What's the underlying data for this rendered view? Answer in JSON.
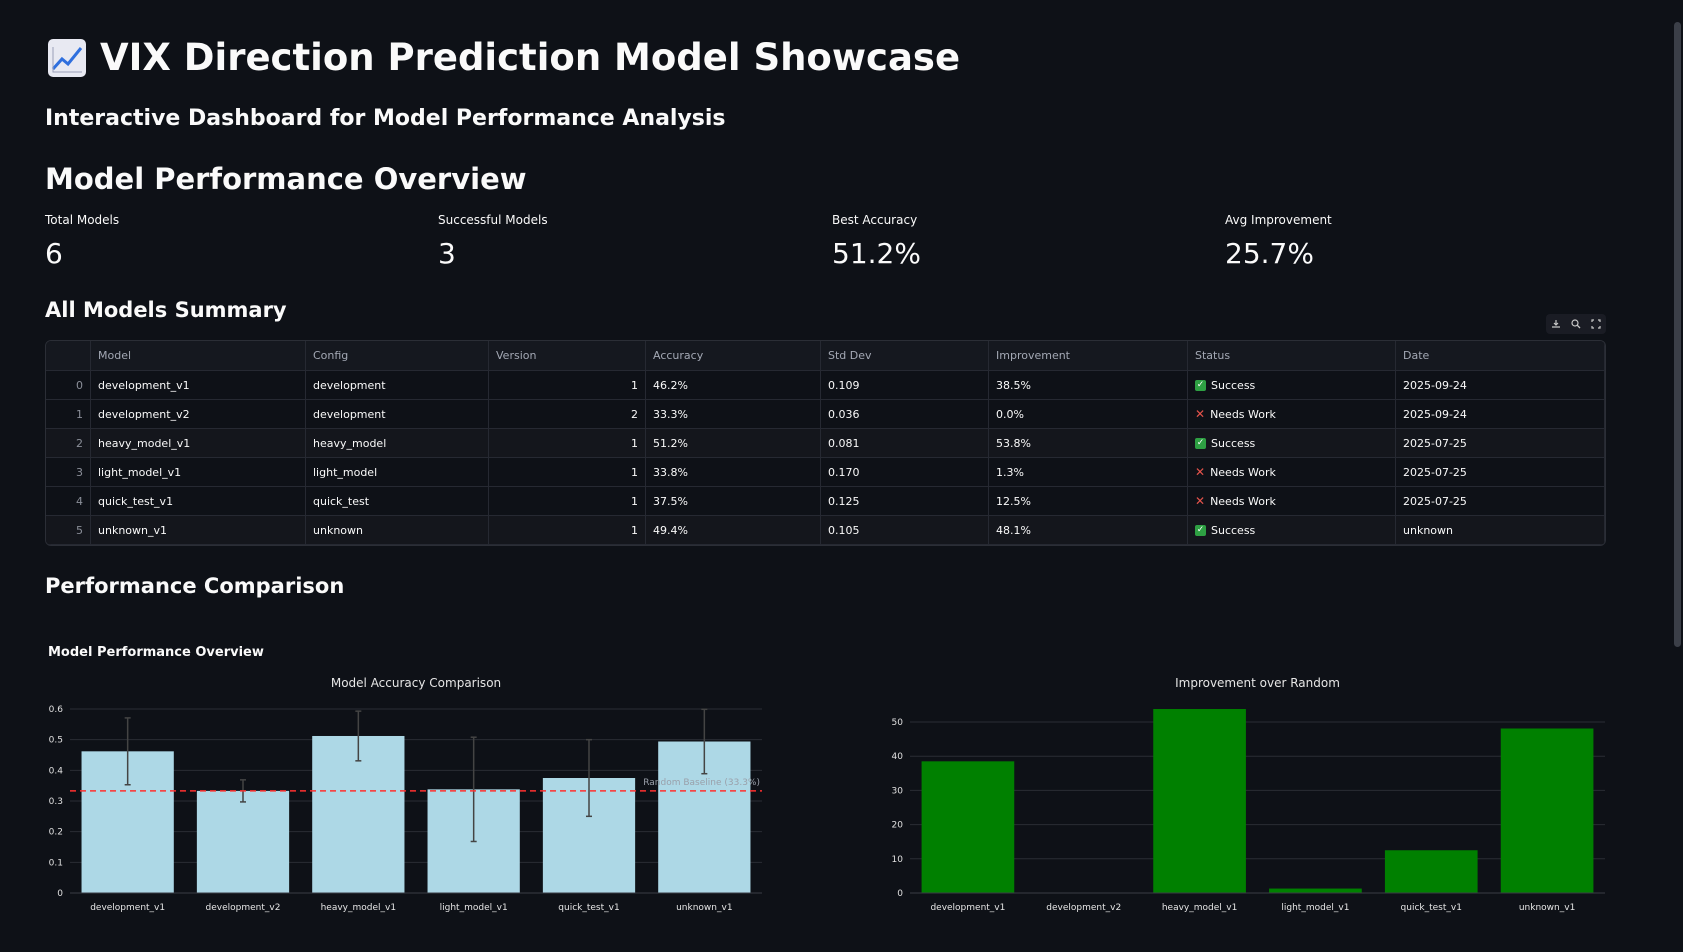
{
  "header": {
    "icon": "chart-increasing-icon",
    "title": "VIX Direction Prediction Model Showcase",
    "subtitle": "Interactive Dashboard for Model Performance Analysis"
  },
  "overview": {
    "heading": "Model Performance Overview",
    "metrics": [
      {
        "label": "Total Models",
        "value": "6"
      },
      {
        "label": "Successful Models",
        "value": "3"
      },
      {
        "label": "Best Accuracy",
        "value": "51.2%"
      },
      {
        "label": "Avg Improvement",
        "value": "25.7%"
      }
    ]
  },
  "summary": {
    "heading": "All Models Summary",
    "toolbar": [
      "download-icon",
      "search-icon",
      "fullscreen-icon"
    ],
    "columns": [
      "",
      "Model",
      "Config",
      "Version",
      "Accuracy",
      "Std Dev",
      "Improvement",
      "Status",
      "Date"
    ],
    "rows": [
      {
        "idx": "0",
        "model": "development_v1",
        "config": "development",
        "version": "1",
        "accuracy": "46.2%",
        "std": "0.109",
        "improvement": "38.5%",
        "status": "Success",
        "ok": true,
        "date": "2025-09-24"
      },
      {
        "idx": "1",
        "model": "development_v2",
        "config": "development",
        "version": "2",
        "accuracy": "33.3%",
        "std": "0.036",
        "improvement": "0.0%",
        "status": "Needs Work",
        "ok": false,
        "date": "2025-09-24"
      },
      {
        "idx": "2",
        "model": "heavy_model_v1",
        "config": "heavy_model",
        "version": "1",
        "accuracy": "51.2%",
        "std": "0.081",
        "improvement": "53.8%",
        "status": "Success",
        "ok": true,
        "date": "2025-07-25"
      },
      {
        "idx": "3",
        "model": "light_model_v1",
        "config": "light_model",
        "version": "1",
        "accuracy": "33.8%",
        "std": "0.170",
        "improvement": "1.3%",
        "status": "Needs Work",
        "ok": false,
        "date": "2025-07-25"
      },
      {
        "idx": "4",
        "model": "quick_test_v1",
        "config": "quick_test",
        "version": "1",
        "accuracy": "37.5%",
        "std": "0.125",
        "improvement": "12.5%",
        "status": "Needs Work",
        "ok": false,
        "date": "2025-07-25"
      },
      {
        "idx": "5",
        "model": "unknown_v1",
        "config": "unknown",
        "version": "1",
        "accuracy": "49.4%",
        "std": "0.105",
        "improvement": "48.1%",
        "status": "Success",
        "ok": true,
        "date": "unknown"
      }
    ]
  },
  "comparison": {
    "heading": "Performance Comparison",
    "figure_title": "Model Performance Overview"
  },
  "chart_data": [
    {
      "type": "bar",
      "title": "Model Accuracy Comparison",
      "categories": [
        "development_v1",
        "development_v2",
        "heavy_model_v1",
        "light_model_v1",
        "quick_test_v1",
        "unknown_v1"
      ],
      "values": [
        0.462,
        0.333,
        0.512,
        0.338,
        0.375,
        0.494
      ],
      "error": [
        0.109,
        0.036,
        0.081,
        0.17,
        0.125,
        0.105
      ],
      "ylim": [
        0,
        0.6
      ],
      "yticks": [
        0,
        0.1,
        0.2,
        0.3,
        0.4,
        0.5,
        0.6
      ],
      "baseline": {
        "value": 0.333,
        "label": "Random Baseline (33.3%)",
        "color": "#ff3030"
      },
      "bar_color": "#add8e6",
      "grid": true
    },
    {
      "type": "bar",
      "title": "Improvement over Random",
      "categories": [
        "development_v1",
        "development_v2",
        "heavy_model_v1",
        "light_model_v1",
        "quick_test_v1",
        "unknown_v1"
      ],
      "values": [
        38.5,
        0.0,
        53.8,
        1.3,
        12.5,
        48.1
      ],
      "ylim": [
        0,
        53.8
      ],
      "yticks": [
        0,
        10,
        20,
        30,
        40,
        50
      ],
      "bar_color": "#008000",
      "grid": true
    }
  ]
}
